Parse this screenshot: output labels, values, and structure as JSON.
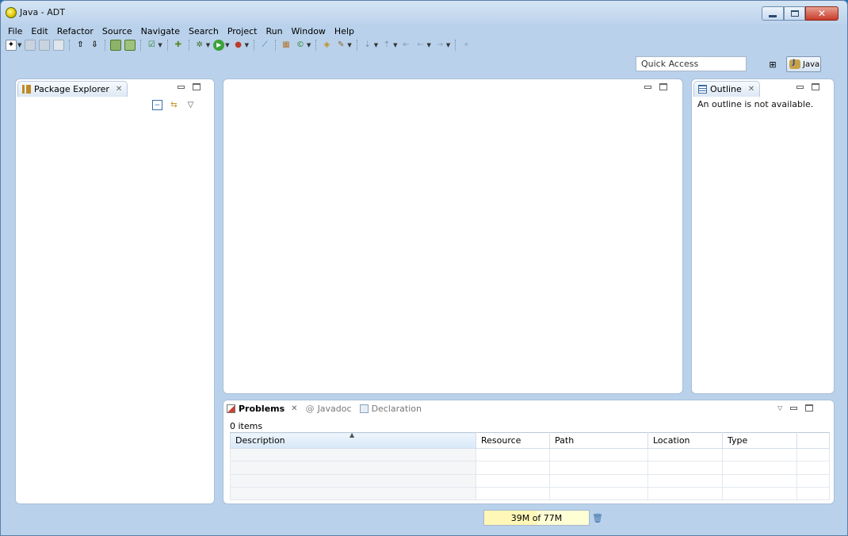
{
  "window": {
    "title": "Java - ADT"
  },
  "menu": [
    "File",
    "Edit",
    "Refactor",
    "Source",
    "Navigate",
    "Search",
    "Project",
    "Run",
    "Window",
    "Help"
  ],
  "toolbar": {
    "quick_access_placeholder": "Quick Access",
    "perspective_label": "Java"
  },
  "package_explorer": {
    "title": "Package Explorer"
  },
  "outline": {
    "title": "Outline",
    "message": "An outline is not available."
  },
  "problems": {
    "tabs": [
      {
        "label": "Problems",
        "active": true
      },
      {
        "label": "Javadoc",
        "active": false
      },
      {
        "label": "Declaration",
        "active": false
      }
    ],
    "items_count": "0 items",
    "columns": [
      "Description",
      "Resource",
      "Path",
      "Location",
      "Type"
    ]
  },
  "status": {
    "heap_label": "39M of 77M",
    "heap_used_fraction": 0.51
  },
  "colors": {
    "window_bg": "#b9d1ea",
    "panel_border": "#aac0d8",
    "heap_bg": "#ffffd6"
  }
}
